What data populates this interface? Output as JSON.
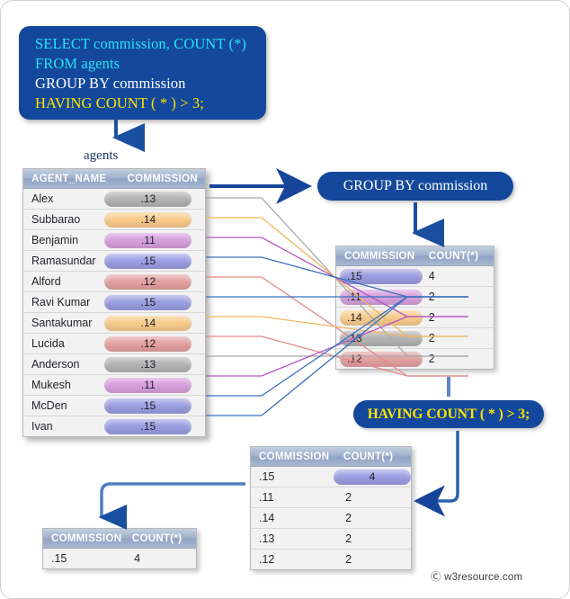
{
  "query_box": {
    "lines": [
      {
        "text": "SELECT commission, COUNT (*)",
        "color": "#25e3f5"
      },
      {
        "text": "FROM agents",
        "color": "#25e3f5"
      },
      {
        "text": "GROUP BY commission",
        "color": "#ffffff"
      },
      {
        "text": "HAVING COUNT ( * ) > 3;",
        "color": "#ffe600"
      }
    ],
    "line1": "SELECT commission, COUNT (*)",
    "line2": "FROM agents",
    "line3": "GROUP BY commission",
    "line4": "HAVING COUNT ( * ) > 3;"
  },
  "agents": {
    "caption": "agents",
    "columns": [
      "AGENT_NAME",
      "COMMISSION"
    ],
    "col1": "AGENT_NAME",
    "col2": "COMMISSION",
    "rows": [
      {
        "name": "Alex",
        "commission": ".13",
        "color": "#b3b3b3"
      },
      {
        "name": "Subbarao",
        "commission": ".14",
        "color": "#f8cb8c"
      },
      {
        "name": "Benjamin",
        "commission": ".11",
        "color": "#d79fdd"
      },
      {
        "name": "Ramasundar",
        "commission": ".15",
        "color": "#9a9ee0"
      },
      {
        "name": "Alford",
        "commission": ".12",
        "color": "#e2a0a0"
      },
      {
        "name": "Ravi Kumar",
        "commission": ".15",
        "color": "#9a9ee0"
      },
      {
        "name": "Santakumar",
        "commission": ".14",
        "color": "#f8cb8c"
      },
      {
        "name": "Lucida",
        "commission": ".12",
        "color": "#e2a0a0"
      },
      {
        "name": "Anderson",
        "commission": ".13",
        "color": "#b3b3b3"
      },
      {
        "name": "Mukesh",
        "commission": ".11",
        "color": "#d79fdd"
      },
      {
        "name": "McDen",
        "commission": ".15",
        "color": "#9a9ee0"
      },
      {
        "name": "Ivan",
        "commission": ".15",
        "color": "#9a9ee0"
      }
    ]
  },
  "group_banner": {
    "label": "GROUP BY commission"
  },
  "having_banner": {
    "label": "HAVING COUNT ( * ) > 3;"
  },
  "group_table": {
    "columns": [
      "COMMISSION",
      "COUNT(*)"
    ],
    "col1": "COMMISSION",
    "col2": "COUNT(*)",
    "rows": [
      {
        "commission": ".15",
        "count": "4",
        "color": "#9a9ee0"
      },
      {
        "commission": ".11",
        "count": "2",
        "color": "#d79fdd"
      },
      {
        "commission": ".14",
        "count": "2",
        "color": "#f8cb8c"
      },
      {
        "commission": ".13",
        "count": "2",
        "color": "#b3b3b3"
      },
      {
        "commission": ".12",
        "count": "2",
        "color": "#e2a0a0"
      }
    ]
  },
  "having_table": {
    "columns": [
      "COMMISSION",
      "COUNT(*)"
    ],
    "col1": "COMMISSION",
    "col2": "COUNT(*)",
    "rows": [
      {
        "commission": ".15",
        "count": "4",
        "highlight": true
      },
      {
        "commission": ".11",
        "count": "2",
        "highlight": false
      },
      {
        "commission": ".14",
        "count": "2",
        "highlight": false
      },
      {
        "commission": ".13",
        "count": "2",
        "highlight": false
      },
      {
        "commission": ".12",
        "count": "2",
        "highlight": false
      }
    ]
  },
  "result_table": {
    "columns": [
      "COMMISSION",
      "COUNT(*)"
    ],
    "col1": "COMMISSION",
    "col2": "COUNT(*)",
    "rows": [
      {
        "commission": ".15",
        "count": "4"
      }
    ]
  },
  "colors": {
    "brand_blue": "#14489c",
    "arrow_blue": "#1a4fa0",
    "wire_blue": "#5b86c7",
    "highlight_pill": "#9a9ee0"
  },
  "footer": {
    "watermark": "Ⓒ w3resource.com"
  }
}
